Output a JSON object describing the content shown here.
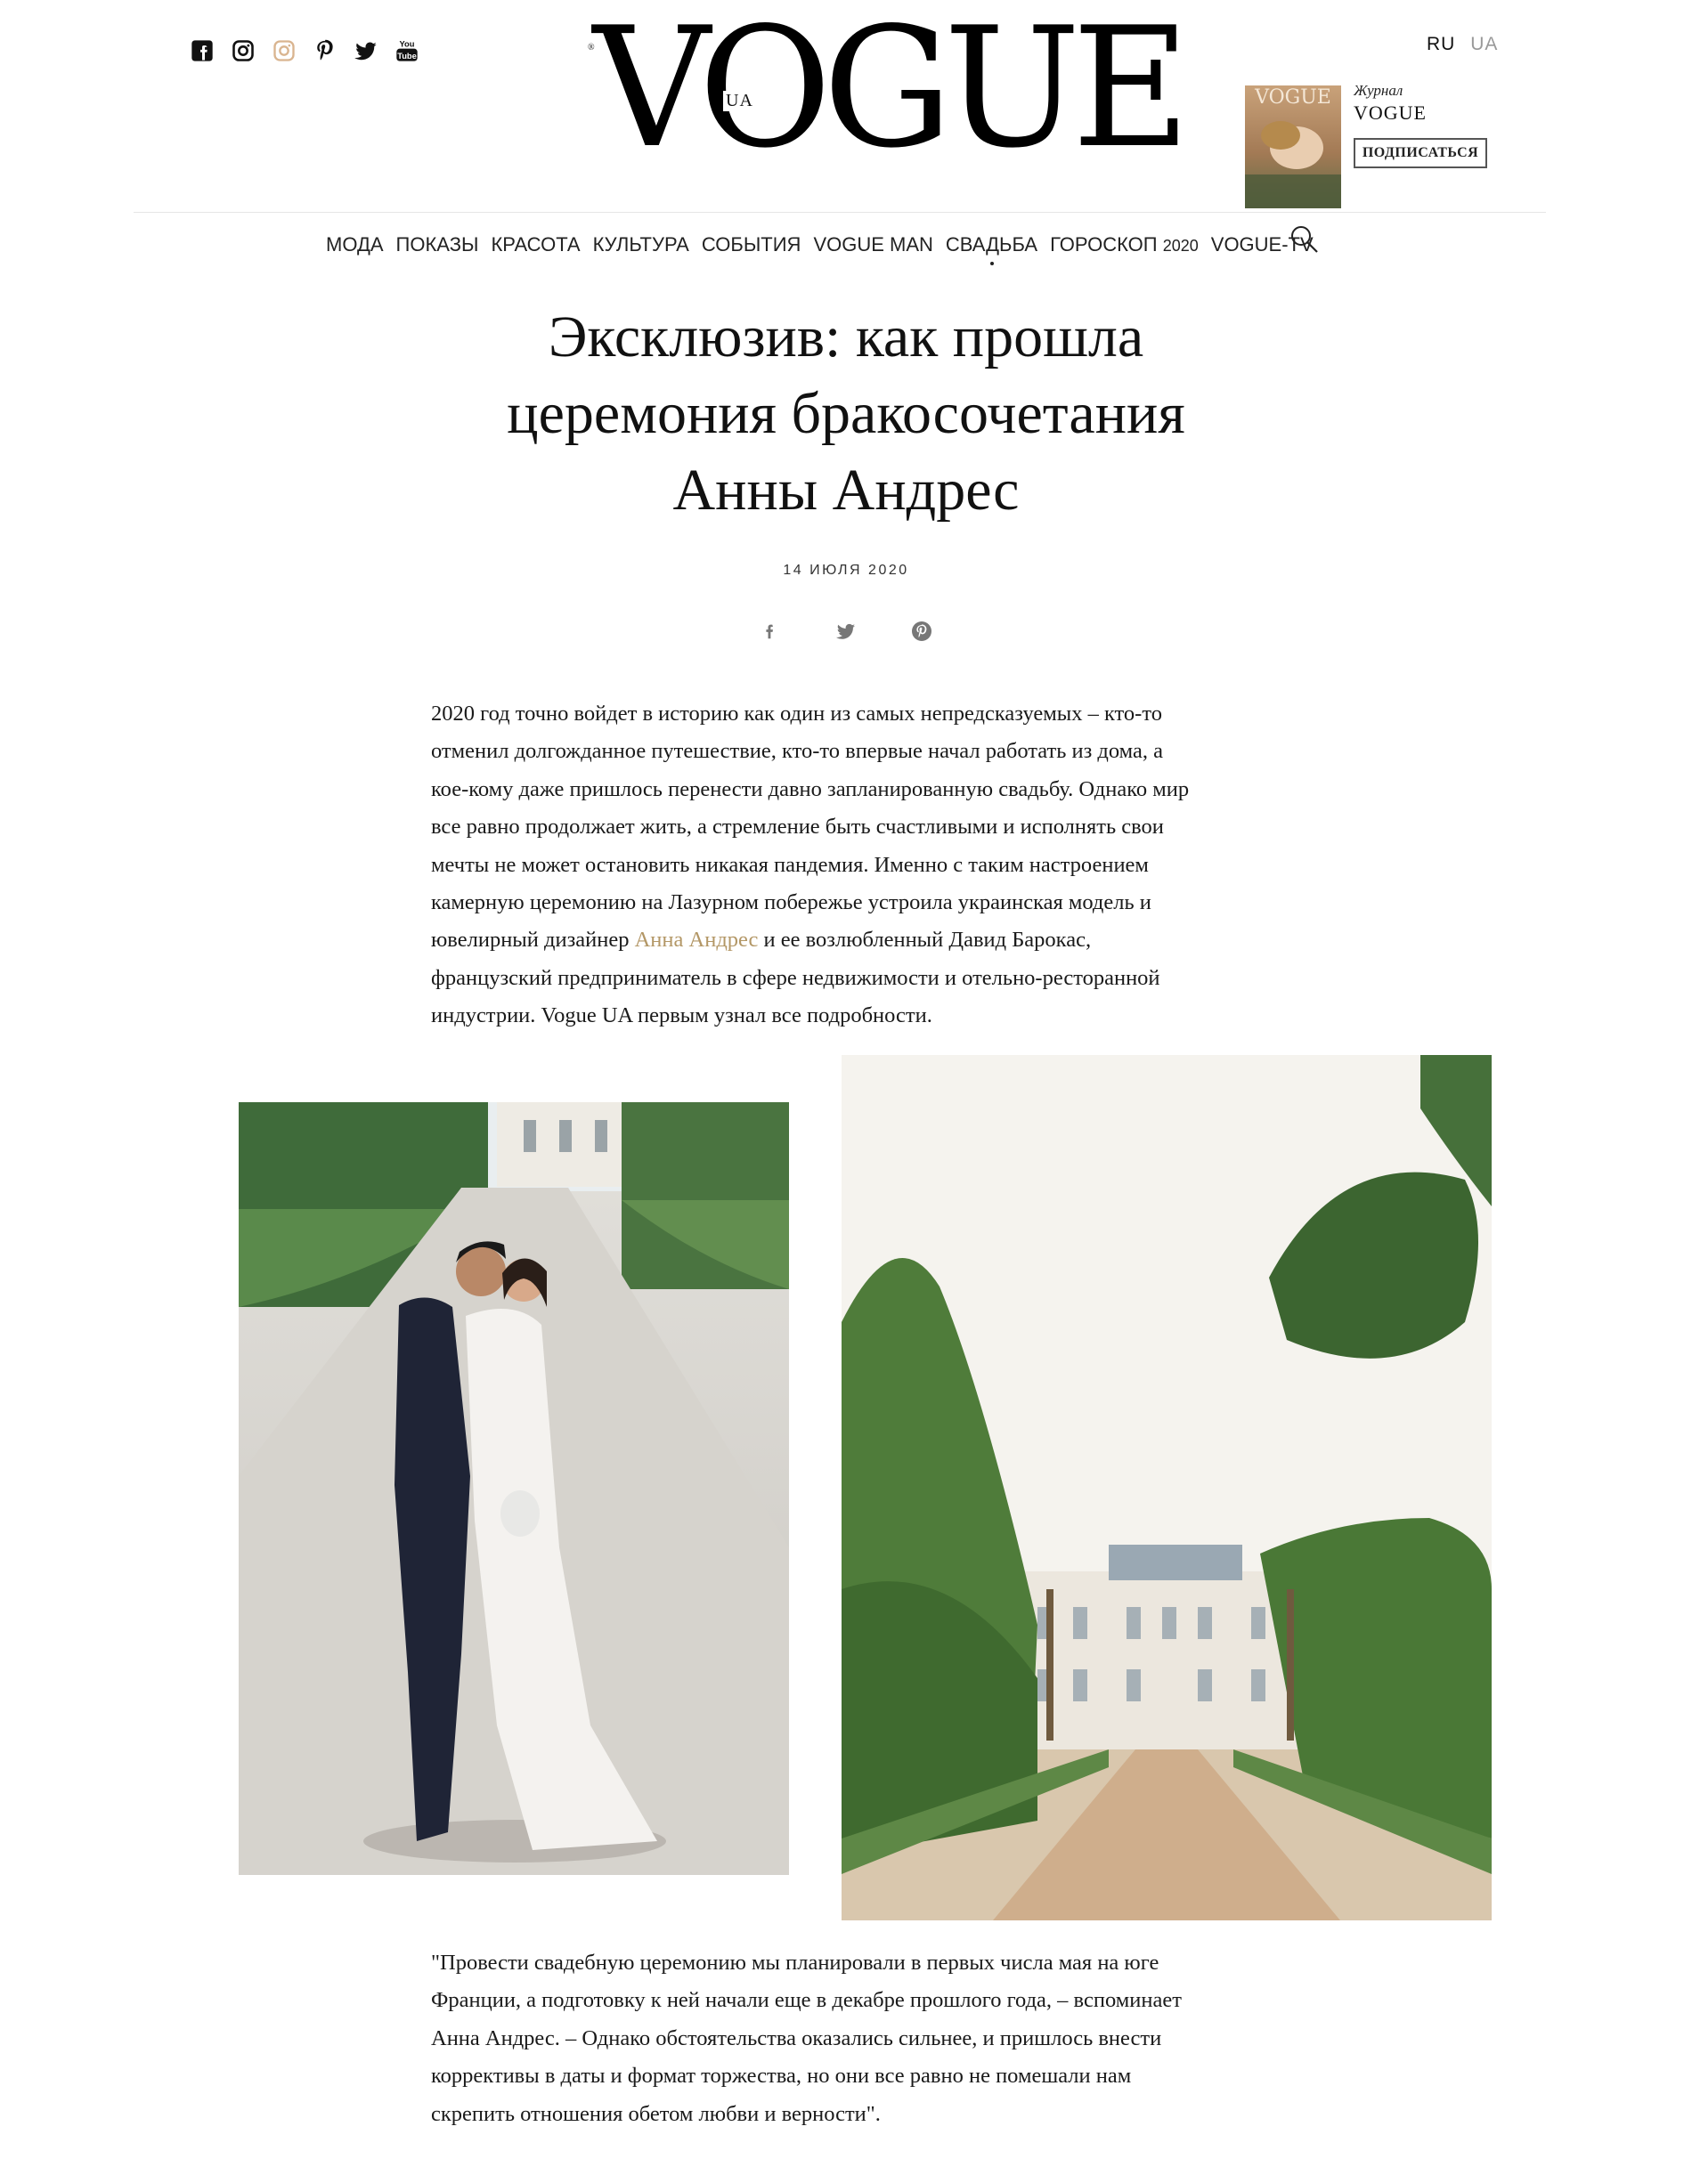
{
  "header": {
    "logo": "VOGUE",
    "logo_edition": "UA",
    "logo_reg": "®",
    "social": [
      "facebook-icon",
      "instagram-icon",
      "instagram-outline-icon",
      "pinterest-icon",
      "twitter-icon",
      "youtube-icon"
    ],
    "lang_ru": "RU",
    "lang_ua": "UA",
    "magazine_label": "Журнал",
    "magazine_title": "VOGUE",
    "subscribe_label": "ПОДПИСАТЬСЯ",
    "cover_text": "VOGUE"
  },
  "nav": {
    "items": [
      "МОДА",
      "ПОКАЗЫ",
      "КРАСОТА",
      "КУЛЬТУРА",
      "СОБЫТИЯ",
      "VOGUE MAN",
      "СВАДЬБА",
      "ГОРОСКОП",
      "VOGUE-TV"
    ],
    "horoscope_year": "2020"
  },
  "article": {
    "title_line1": "Эксклюзив: как прошла",
    "title_line2": "церемония бракосочетания",
    "title_line3": "Анны Андрес",
    "date": "14 ИЮЛЯ 2020",
    "p1": [
      "2020 год точно войдет в историю как один из самых непредсказуемых – кто-то",
      "отменил долгожданное путешествие, кто-то впервые начал работать из дома, а",
      "кое-кому даже пришлось перенести давно запланированную свадьбу. Однако мир",
      "все равно продолжает жить, а стремление быть счастливыми и исполнять свои",
      "мечты не может остановить никакая пандемия. Именно с таким настроением",
      "камерную церемонию на Лазурном побережье устроила украинская модель и"
    ],
    "p1_line7_before": "ювелирный дизайнер ",
    "p1_link": "Анна Андрес",
    "p1_line7_after": " и ее возлюбленный Давид Барокас,",
    "p1_tail": [
      "французский предприниматель в сфере недвижимости и отельно-ресторанной",
      "индустрии. Vogue UA первым узнал все подробности."
    ],
    "p2": [
      "\"Провести свадебную церемонию мы планировали в первых числа мая на юге",
      "Франции, а подготовку к ней начали еще в декабре прошлого года, – вспоминает",
      "Анна Андрес. – Однако обстоятельства оказались сильнее, и пришлось внести",
      "коррективы в даты и формат торжества, но они все равно не помешали нам",
      "скрепить отношения обетом любви и верности\"."
    ]
  },
  "colors": {
    "link": "#b39766",
    "instagram": "#d9b48f"
  }
}
